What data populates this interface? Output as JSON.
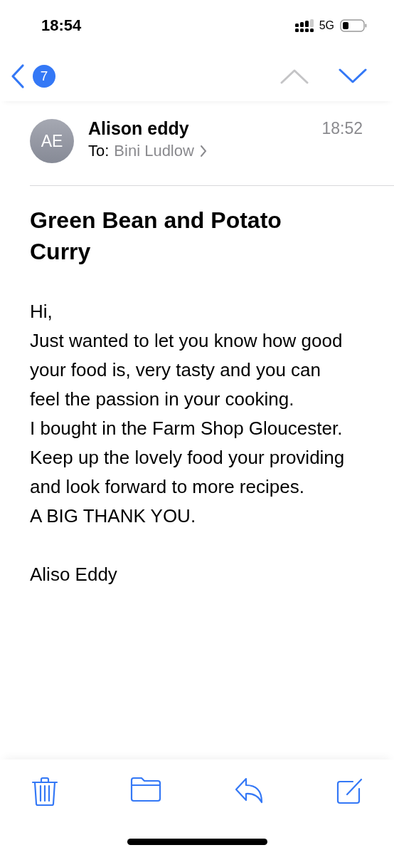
{
  "status_bar": {
    "time": "18:54",
    "network": "5G"
  },
  "nav": {
    "unread_count": "7",
    "previous_disabled": true,
    "next_disabled": false
  },
  "message": {
    "avatar_initials": "AE",
    "sender": "Alison eddy",
    "time": "18:52",
    "to_label": "To:",
    "recipient": "Bini Ludlow",
    "subject": "Green Bean and Potato Curry",
    "body": [
      "Hi,\nJust wanted to let you know how good your food is, very tasty and you can feel the passion in your cooking.\nI bought in the Farm Shop Gloucester.  Keep up the lovely food your providing and look forward to more recipes.\nA BIG THANK YOU.",
      "Aliso Eddy"
    ]
  },
  "toolbar": [
    {
      "kind": "trash"
    },
    {
      "kind": "folder"
    },
    {
      "kind": "reply"
    },
    {
      "kind": "compose"
    }
  ]
}
